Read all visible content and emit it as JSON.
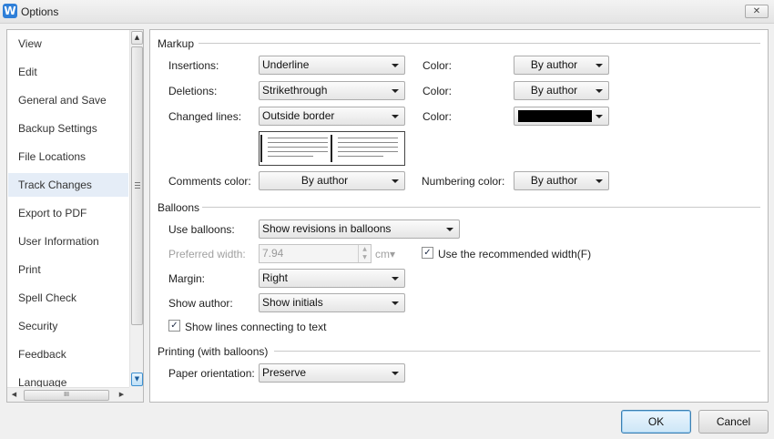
{
  "window": {
    "title": "Options",
    "app_icon_letter": "W",
    "close_glyph": "✕"
  },
  "sidebar": {
    "items": [
      {
        "label": "View"
      },
      {
        "label": "Edit"
      },
      {
        "label": "General and Save"
      },
      {
        "label": "Backup Settings"
      },
      {
        "label": "File Locations"
      },
      {
        "label": "Track Changes",
        "selected": true
      },
      {
        "label": "Export to PDF"
      },
      {
        "label": "User Information"
      },
      {
        "label": "Print"
      },
      {
        "label": "Spell Check"
      },
      {
        "label": "Security"
      },
      {
        "label": "Feedback"
      },
      {
        "label": "Language"
      }
    ],
    "scroll_up_glyph": "▲",
    "scroll_down_glyph": "▼",
    "scroll_left_glyph": "◀",
    "scroll_right_glyph": "▶",
    "hthumb_grip": "III"
  },
  "markup": {
    "title": "Markup",
    "insertions_label": "Insertions:",
    "insertions_value": "Underline",
    "deletions_label": "Deletions:",
    "deletions_value": "Strikethrough",
    "changed_lines_label": "Changed lines:",
    "changed_lines_value": "Outside border",
    "color_label": "Color:",
    "insertions_color": "By author",
    "deletions_color": "By author",
    "changed_lines_color": "#000000",
    "comments_color_label": "Comments color:",
    "comments_color_value": "By author",
    "numbering_color_label": "Numbering color:",
    "numbering_color_value": "By author"
  },
  "balloons": {
    "title": "Balloons",
    "use_balloons_label": "Use balloons:",
    "use_balloons_value": "Show revisions in balloons",
    "preferred_width_label": "Preferred width:",
    "preferred_width_value": "7.94",
    "preferred_width_unit": "cm▾",
    "use_recommended_label": "Use the recommended width(F)",
    "use_recommended_checked": true,
    "margin_label": "Margin:",
    "margin_value": "Right",
    "show_author_label": "Show author:",
    "show_author_value": "Show initials",
    "show_lines_label": "Show lines connecting to text",
    "show_lines_checked": true
  },
  "printing": {
    "title": "Printing (with balloons)",
    "paper_orientation_label": "Paper orientation:",
    "paper_orientation_value": "Preserve"
  },
  "buttons": {
    "ok": "OK",
    "cancel": "Cancel"
  },
  "check_glyph": "✓",
  "spin_up_glyph": "▲",
  "spin_down_glyph": "▼"
}
